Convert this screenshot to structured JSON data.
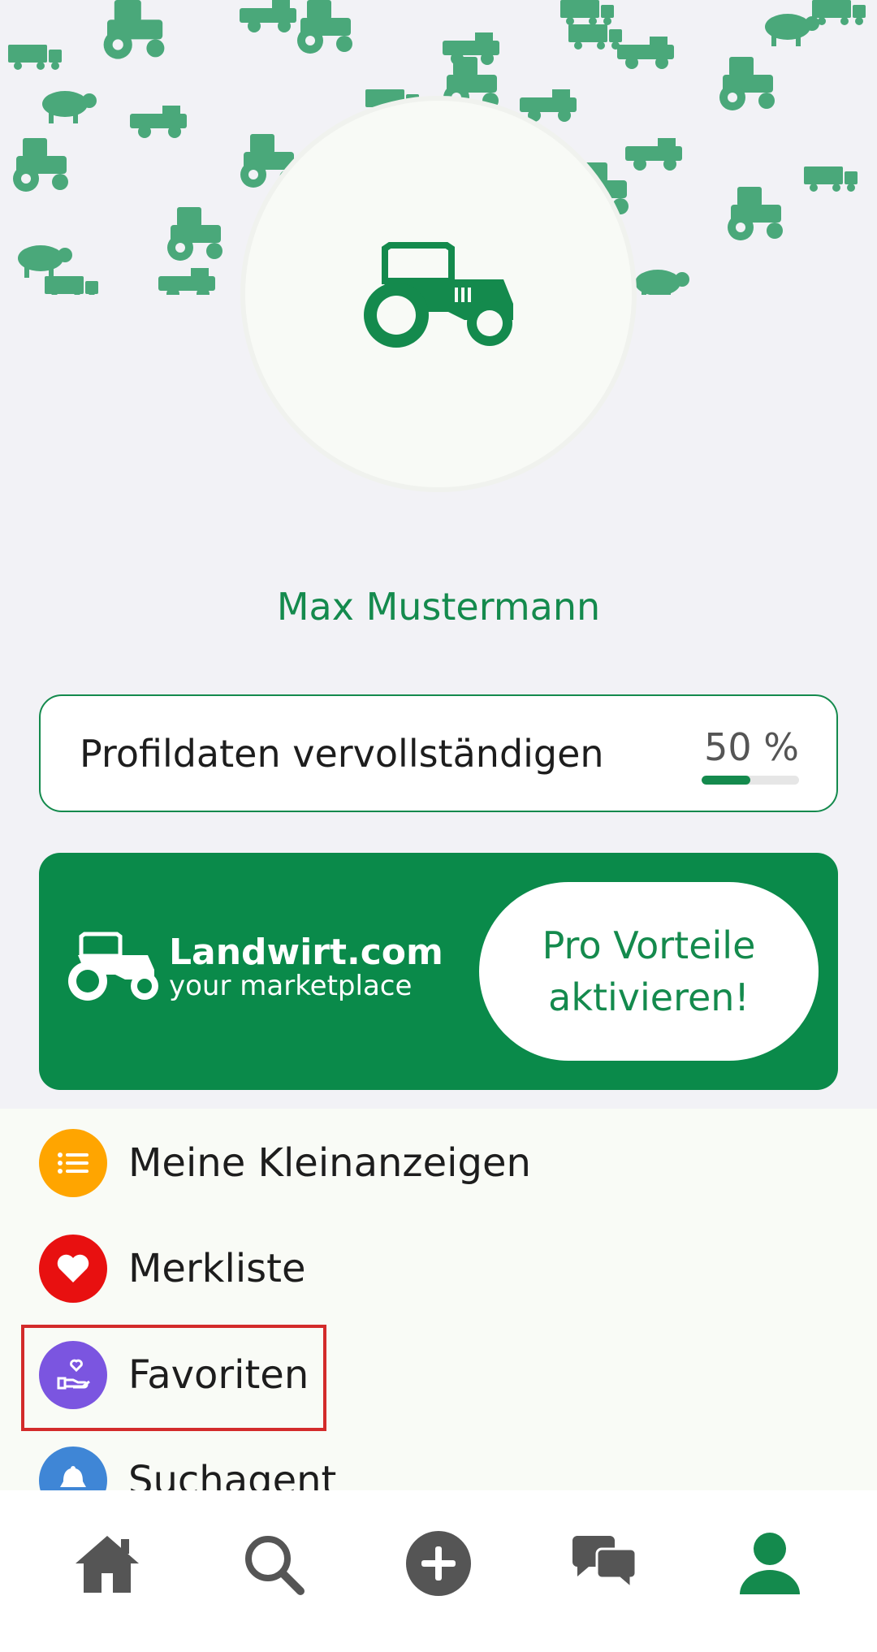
{
  "profile": {
    "name": "Max Mustermann",
    "completion_label": "Profildaten vervollständigen",
    "completion_percent_text": "50 %",
    "completion_fraction": 0.5
  },
  "promo": {
    "brand_name": "Landwirt.com",
    "brand_tagline": "your marketplace",
    "button_line1": "Pro Vorteile",
    "button_line2": "aktivieren!"
  },
  "menu": {
    "items": [
      {
        "label": "Meine Kleinanzeigen",
        "icon": "list-icon",
        "color": "#ffa500"
      },
      {
        "label": "Merkliste",
        "icon": "heart-icon",
        "color": "#e81010"
      },
      {
        "label": "Favoriten",
        "icon": "hand-heart-icon",
        "color": "#7b55e0"
      },
      {
        "label": "Suchagent",
        "icon": "bell-icon",
        "color": "#3f86d6"
      }
    ]
  },
  "bottom_nav": {
    "items": [
      "home-icon",
      "search-icon",
      "add-icon",
      "chat-icon",
      "profile-icon"
    ],
    "active": "profile-icon"
  },
  "colors": {
    "brand_green": "#148a4d",
    "promo_green": "#0a8a4a",
    "highlight_red": "#d32b2b"
  }
}
